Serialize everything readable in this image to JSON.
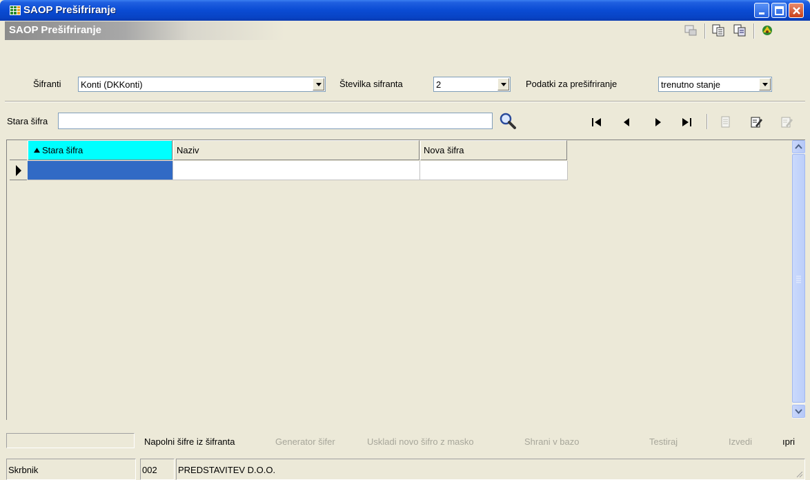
{
  "window": {
    "title": "SAOP Prešifriranje",
    "header_title": "SAOP Prešifriranje",
    "accent": "#0a4bd3"
  },
  "filters": {
    "sifranti_label": "Šifranti",
    "sifranti_value": "Konti  (DKKonti)",
    "stevilka_label": "Številka sifranta",
    "stevilka_value": "2",
    "podatki_label": "Podatki za prešifriranje",
    "podatki_value": "trenutno stanje"
  },
  "search": {
    "label": "Stara šifra",
    "value": ""
  },
  "grid": {
    "columns": [
      "Stara šifra",
      "Naziv",
      "Nova šifra"
    ],
    "sorted_column_color": "#00ffff",
    "selected_cell_color": "#316ac5",
    "rows": [
      [
        "",
        "",
        ""
      ]
    ]
  },
  "footer": {
    "actions": [
      {
        "label": "Napolni šifre iz šifranta",
        "enabled": true
      },
      {
        "label": "Generator šifer",
        "enabled": false
      },
      {
        "label": "Uskladi novo šifro z masko",
        "enabled": false
      },
      {
        "label": "Shrani v bazo",
        "enabled": false
      },
      {
        "label": "Testiraj",
        "enabled": false
      },
      {
        "label": "Izvedi",
        "enabled": false
      },
      {
        "label": "ıpri",
        "enabled": true
      }
    ]
  },
  "statusbar": {
    "user": "Skrbnik",
    "code": "002",
    "company": "PREDSTAVITEV D.O.O."
  }
}
